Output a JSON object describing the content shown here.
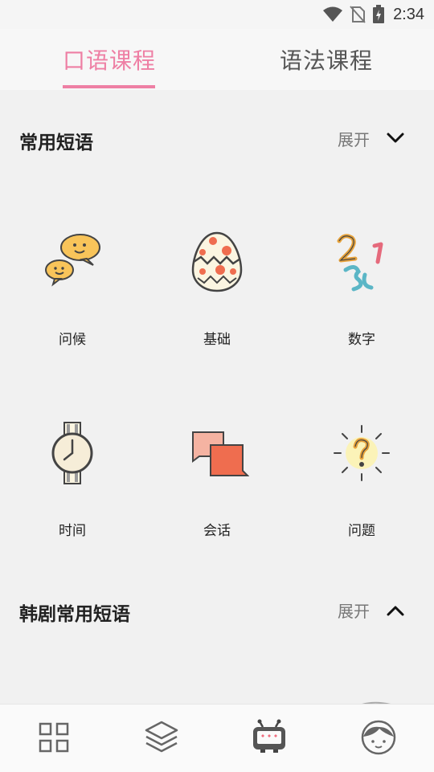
{
  "status_bar": {
    "time": "2:34",
    "icons": [
      "wifi-icon",
      "no-sim-icon",
      "battery-charging-icon"
    ]
  },
  "tabs": [
    {
      "label": "口语课程",
      "active": true
    },
    {
      "label": "语法课程",
      "active": false
    }
  ],
  "colors": {
    "accent": "#ee7fa4",
    "background": "#f1f1f1"
  },
  "sections": [
    {
      "title": "常用短语",
      "toggle_label": "展开",
      "chevron": "chevron-down-icon",
      "items": [
        {
          "label": "问候",
          "icon": "speech-bubbles-icon"
        },
        {
          "label": "基础",
          "icon": "egg-icon"
        },
        {
          "label": "数字",
          "icon": "numbers-icon"
        },
        {
          "label": "时间",
          "icon": "watch-icon"
        },
        {
          "label": "会话",
          "icon": "conversation-icon"
        },
        {
          "label": "问题",
          "icon": "question-icon"
        }
      ]
    },
    {
      "title": "韩剧常用短语",
      "toggle_label": "展开",
      "chevron": "chevron-up-icon"
    }
  ],
  "bottom_nav": [
    {
      "icon": "grid-icon",
      "active": false
    },
    {
      "icon": "layers-icon",
      "active": false
    },
    {
      "icon": "tv-icon",
      "active": true
    },
    {
      "icon": "profile-face-icon",
      "active": false
    }
  ]
}
